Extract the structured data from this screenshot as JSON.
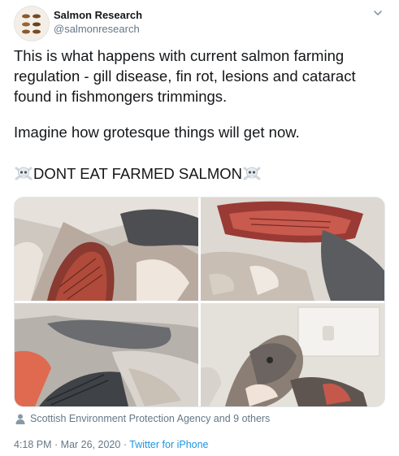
{
  "author": {
    "name": "Salmon Research",
    "handle": "@salmonresearch"
  },
  "tweet": {
    "paragraph1": "This is what happens with current salmon farming regulation - gill disease, fin rot, lesions and cataract found in fishmongers trimmings.",
    "paragraph2": "Imagine how grotesque things will get now.",
    "paragraph3": "DONT EAT FARMED SALMON"
  },
  "media": {
    "photos": [
      {
        "icon": "fish-gill-photo"
      },
      {
        "icon": "fish-head-photo"
      },
      {
        "icon": "fish-trimmings-photo"
      },
      {
        "icon": "salmon-head-in-bin-photo"
      }
    ]
  },
  "tagged": {
    "text": "Scottish Environment Protection Agency and 9 others"
  },
  "meta": {
    "time": "4:18 PM",
    "separator1": " · ",
    "date": "Mar 26, 2020",
    "separator2": " · ",
    "source": "Twitter for iPhone"
  },
  "colors": {
    "text": "#14171a",
    "secondary": "#657786",
    "link": "#1b95e0"
  }
}
